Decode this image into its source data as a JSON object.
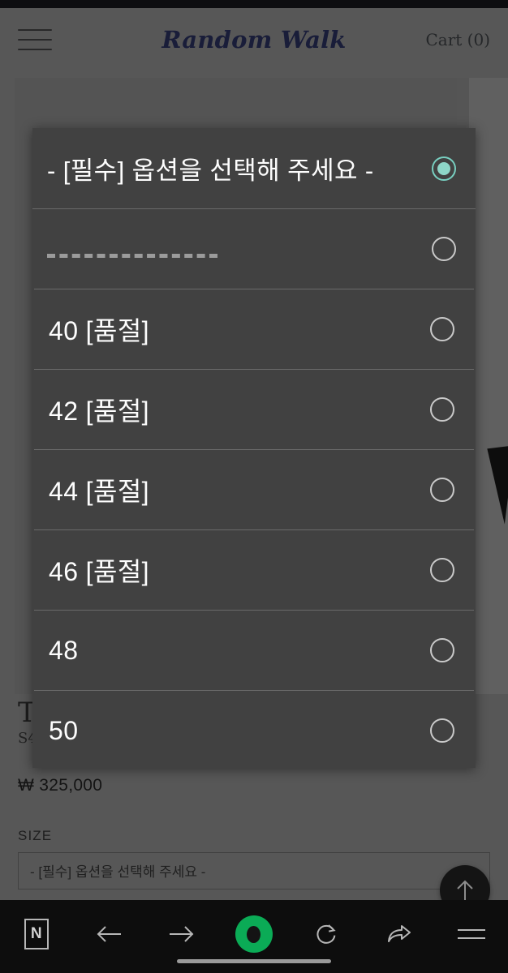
{
  "site": {
    "brand": "Random Walk",
    "cart_label": "Cart (0)",
    "menu_icon": "hamburger-icon"
  },
  "product": {
    "title": "T",
    "subtitle": "S4",
    "price": "₩ 325,000",
    "option_group_label": "SIZE",
    "select_value": "- [필수] 옵션을 선택해 주세요 -",
    "select_caret": "▼"
  },
  "picker": {
    "options": [
      {
        "label": "- [필수] 옵션을 선택해 주세요 -",
        "type": "text",
        "selected": true
      },
      {
        "label": "----------------------",
        "type": "divider",
        "selected": false
      },
      {
        "label": "40 [품절]",
        "type": "text",
        "selected": false
      },
      {
        "label": "42 [품절]",
        "type": "text",
        "selected": false
      },
      {
        "label": "44 [품절]",
        "type": "text",
        "selected": false
      },
      {
        "label": "46 [품절]",
        "type": "text",
        "selected": false
      },
      {
        "label": "48",
        "type": "text",
        "selected": false
      },
      {
        "label": "50",
        "type": "text",
        "selected": false
      }
    ],
    "selected_index": 0,
    "accent_color": "#8ed6c8",
    "background_color": "#414141"
  },
  "scroll_top_button": {
    "icon": "arrow-up-icon"
  },
  "browser_bar": {
    "items": [
      {
        "name": "naver-logo",
        "label": "N"
      },
      {
        "name": "back-arrow-icon",
        "label": ""
      },
      {
        "name": "forward-arrow-icon",
        "label": ""
      },
      {
        "name": "home-icon",
        "label": ""
      },
      {
        "name": "refresh-icon",
        "label": ""
      },
      {
        "name": "share-icon",
        "label": ""
      },
      {
        "name": "menu-icon",
        "label": ""
      }
    ]
  }
}
